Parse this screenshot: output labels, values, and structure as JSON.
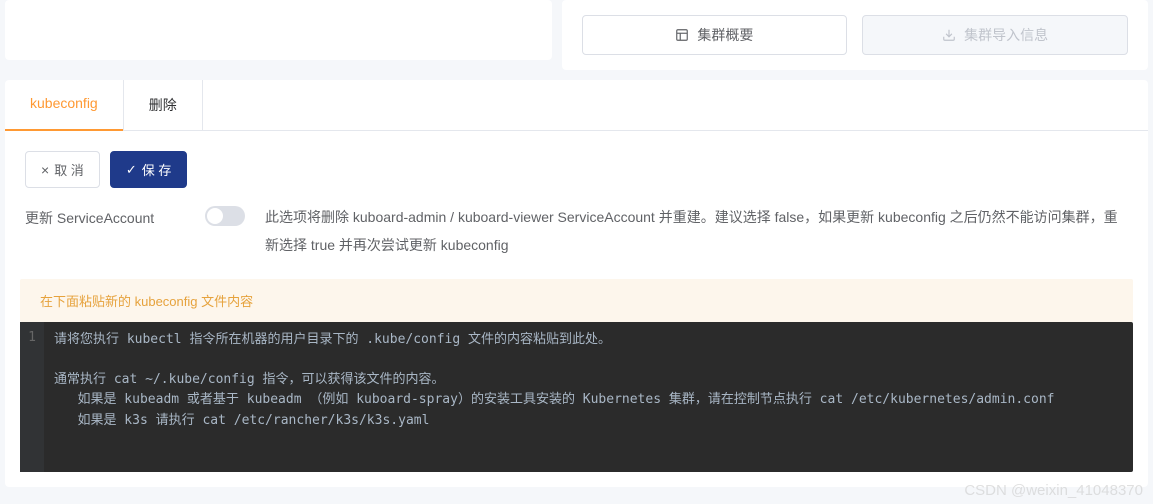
{
  "header": {
    "overview_label": "集群概要",
    "import_label": "集群导入信息"
  },
  "tabs": {
    "kubeconfig": "kubeconfig",
    "delete": "删除"
  },
  "toolbar": {
    "cancel_label": "取 消",
    "save_label": "保 存"
  },
  "form": {
    "update_sa_label": "更新 ServiceAccount",
    "update_sa_desc": "此选项将删除 kuboard-admin / kuboard-viewer ServiceAccount 并重建。建议选择 false，如果更新 kubeconfig 之后仍然不能访问集群，重新选择 true 并再次尝试更新 kubeconfig"
  },
  "notice": {
    "paste_hint": "在下面粘贴新的 kubeconfig 文件内容"
  },
  "editor": {
    "line_number": "1",
    "placeholder": "请将您执行 kubectl 指令所在机器的用户目录下的 .kube/config 文件的内容粘贴到此处。\n\n通常执行 cat ~/.kube/config 指令，可以获得该文件的内容。\n   如果是 kubeadm 或者基于 kubeadm （例如 kuboard-spray）的安装工具安装的 Kubernetes 集群，请在控制节点执行 cat /etc/kubernetes/admin.conf\n   如果是 k3s 请执行 cat /etc/rancher/k3s/k3s.yaml"
  },
  "watermark": "CSDN @weixin_41048370"
}
